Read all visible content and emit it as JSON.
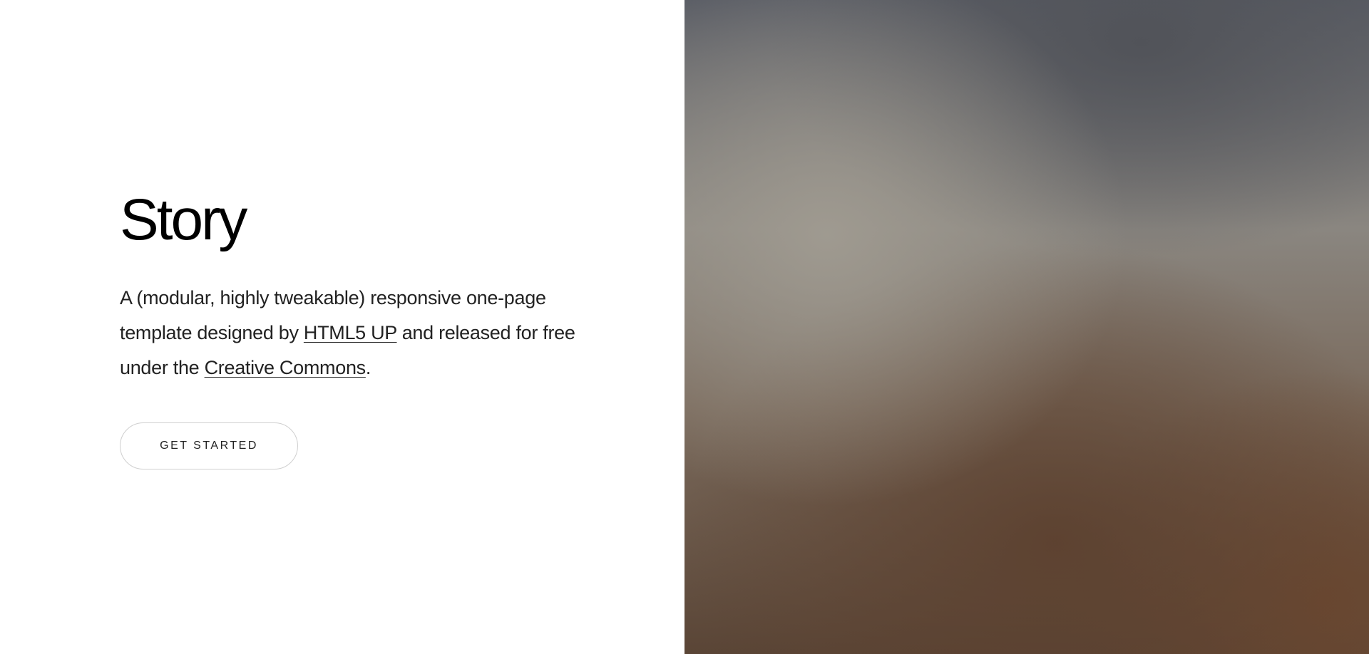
{
  "banner": {
    "title": "Story",
    "description": {
      "part1": "A (modular, highly tweakable) responsive one-page template designed by ",
      "link1": "HTML5 UP",
      "part2": " and released for free under the ",
      "link2": "Creative Commons",
      "part3": "."
    },
    "button_label": "GET STARTED"
  },
  "colors": {
    "background": "#ffffff",
    "text": "#222222",
    "button_border": "#cfcfcf"
  }
}
